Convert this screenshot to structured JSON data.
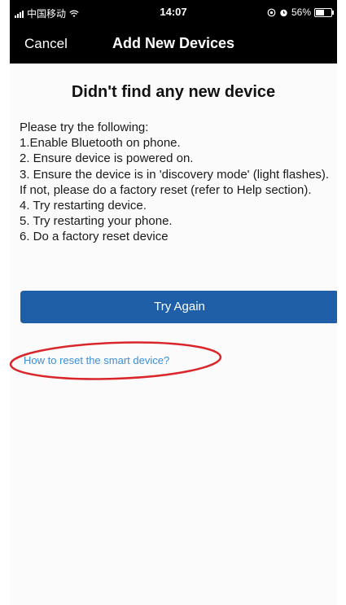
{
  "status_bar": {
    "carrier": "中国移动",
    "time": "14:07",
    "battery": "56%",
    "battery_level": 0.56
  },
  "nav": {
    "cancel": "Cancel",
    "title": "Add New Devices"
  },
  "main": {
    "heading": "Didn't find any new device",
    "instructions": [
      "Please try the following:",
      "1.Enable Bluetooth on phone.",
      "2. Ensure device is powered on.",
      "3. Ensure the device is in 'discovery mode' (light flashes). If not, please do a factory reset (refer to Help section).",
      "4. Try restarting device.",
      "5. Try restarting your phone.",
      "6. Do a factory reset device"
    ],
    "try_again": "Try Again",
    "reset_link": "How to reset the smart device?"
  },
  "colors": {
    "button": "#1f5fa8",
    "link": "#3b8ed8",
    "annotation": "#d9262b"
  }
}
